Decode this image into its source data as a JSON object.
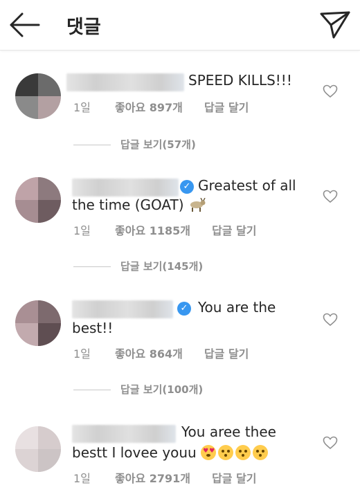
{
  "header": {
    "title": "댓글",
    "back_icon": "arrow-left-icon",
    "send_icon": "paper-plane-icon"
  },
  "comments": [
    {
      "username": "",
      "text": "SPEED KILLS!!!",
      "time": "1일",
      "likes": "좋아요 897개",
      "reply": "답글 달기",
      "view_replies": "답글 보기(57개)"
    },
    {
      "username": "",
      "verified": true,
      "text_line1": "Greatest of all",
      "text_line2": "the time (GOAT)",
      "emoji": "goat",
      "time": "1일",
      "likes": "좋아요 1185개",
      "reply": "답글 달기",
      "view_replies": "답글 보기(145개)"
    },
    {
      "username": "",
      "verified": true,
      "text_line1": "You are the",
      "text_line2": "best!!",
      "time": "1일",
      "likes": "좋아요 864개",
      "reply": "답글 달기",
      "view_replies": "답글 보기(100개)"
    },
    {
      "username": "",
      "text_line1": "You aree thee",
      "text_line2": "bestt I lovee youu",
      "emoji": [
        "heart-eyes",
        "kissing-heart",
        "kissing-heart",
        "kissing-heart"
      ],
      "time": "1일",
      "likes": "좋아요 2791개",
      "reply": "답글 달기"
    }
  ],
  "colors": {
    "text": "#262626",
    "meta": "#8e8e8e",
    "verified": "#3897f0",
    "divider": "#e6e6e6"
  }
}
